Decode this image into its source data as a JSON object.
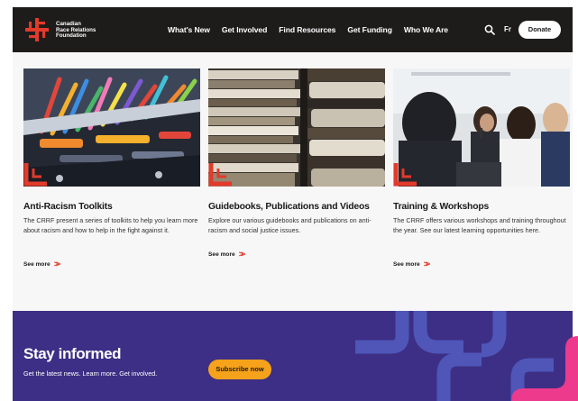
{
  "header": {
    "logo_lines": [
      "Canadian",
      "Race Relations",
      "Foundation"
    ],
    "nav": [
      "What's New",
      "Get Involved",
      "Find Resources",
      "Get Funding",
      "Who We Are"
    ],
    "lang_label": "Fr",
    "donate_label": "Donate"
  },
  "cards": [
    {
      "title": "Anti-Racism Toolkits",
      "description": "The CRRF present a series of toolkits to help you learn more about racism and how to help in the fight against it.",
      "see_more": "See more"
    },
    {
      "title": "Guidebooks, Publications and Videos",
      "description": "Explore our various guidebooks and publications on anti-racism and social justice issues.",
      "see_more": "See more"
    },
    {
      "title": "Training & Workshops",
      "description": "The CRRF offers various workshops and training throughout the year. See our latest learning opportunities here.",
      "see_more": "See more"
    }
  ],
  "newsletter": {
    "title": "Stay informed",
    "subtitle": "Get the latest news. Learn more. Get involved.",
    "button_label": "Subscribe now"
  },
  "colors": {
    "header_bg": "#1e1b1b",
    "brand_red": "#e23a2b",
    "newsletter_bg": "#3c2f85",
    "subscribe_bg": "#f6a21a",
    "accent_pink": "#ee3a8c"
  },
  "icons": [
    "logo-mark-icon",
    "search-icon",
    "chevron-right-double-icon",
    "corner-bracket-icon"
  ]
}
